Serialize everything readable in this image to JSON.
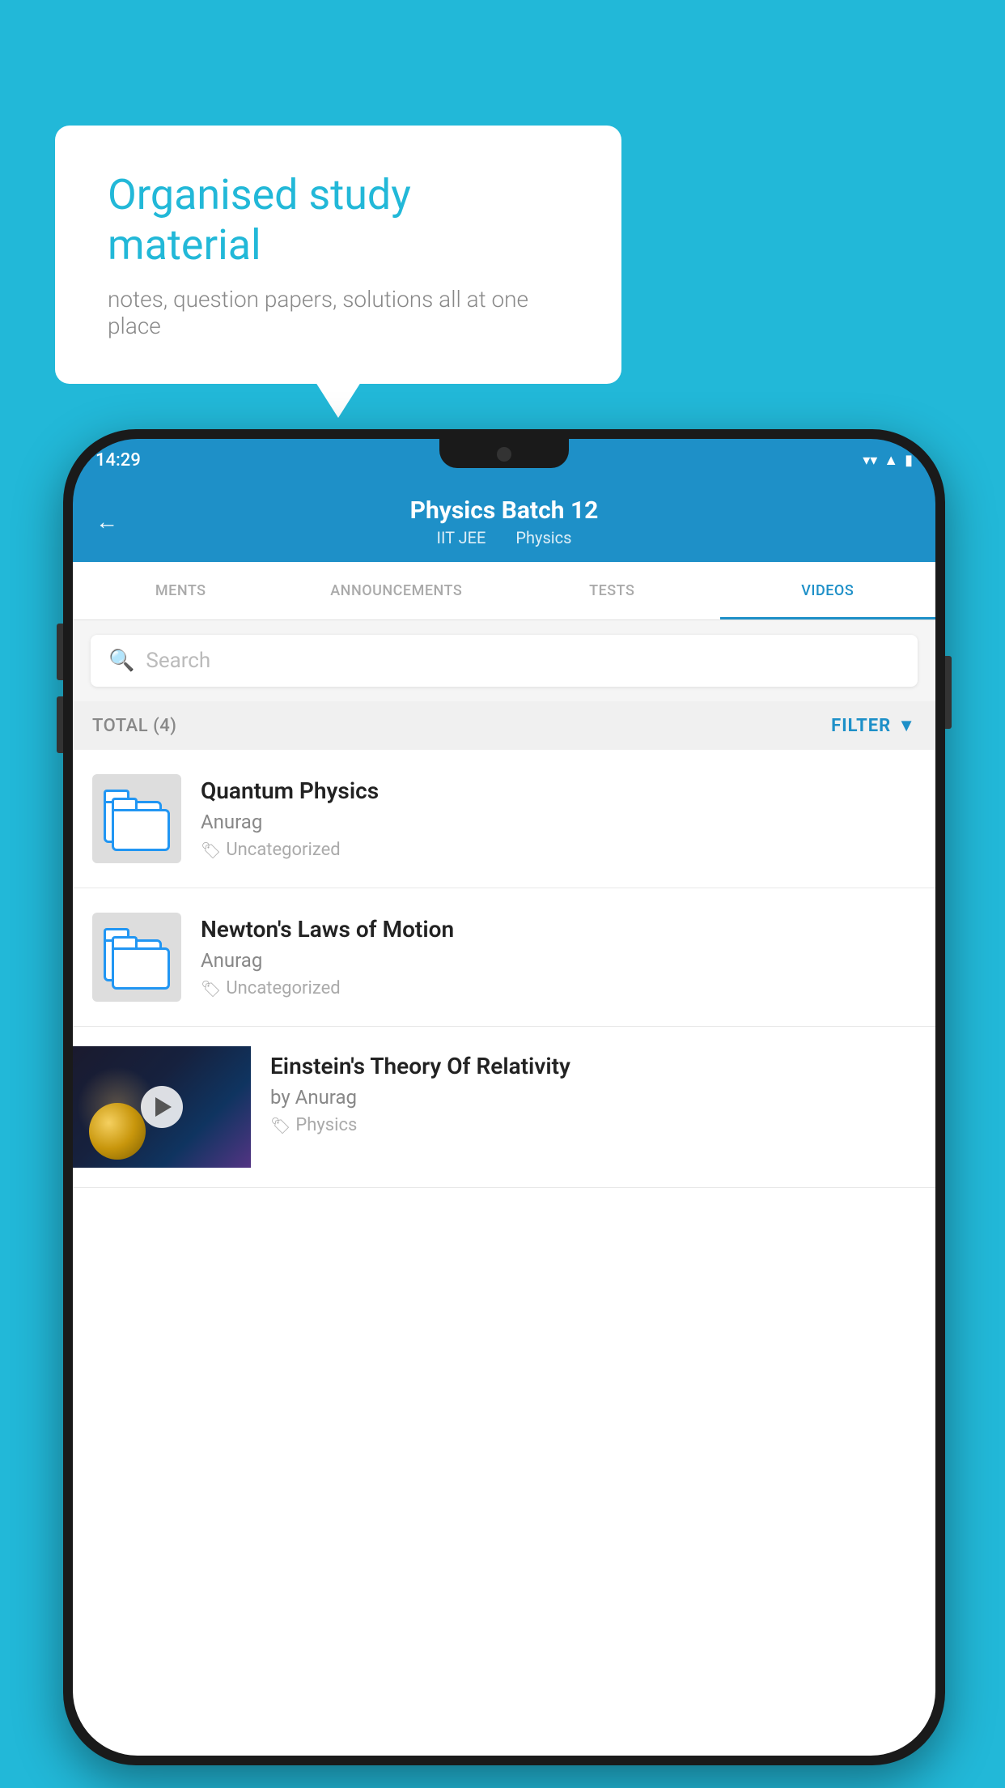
{
  "background": {
    "color": "#22b8d8"
  },
  "speech_bubble": {
    "title": "Organised study material",
    "subtitle": "notes, question papers, solutions all at one place"
  },
  "status_bar": {
    "time": "14:29",
    "wifi_icon": "▾",
    "signal_icon": "▲",
    "battery_icon": "▮"
  },
  "app_header": {
    "back_label": "←",
    "title": "Physics Batch 12",
    "subtitle_part1": "IIT JEE",
    "subtitle_part2": "Physics"
  },
  "tabs": [
    {
      "label": "MENTS",
      "active": false
    },
    {
      "label": "ANNOUNCEMENTS",
      "active": false
    },
    {
      "label": "TESTS",
      "active": false
    },
    {
      "label": "VIDEOS",
      "active": true
    }
  ],
  "search": {
    "placeholder": "Search"
  },
  "filter_bar": {
    "total_label": "TOTAL (4)",
    "filter_label": "FILTER"
  },
  "videos": [
    {
      "title": "Quantum Physics",
      "author": "Anurag",
      "tag": "Uncategorized",
      "has_thumbnail": false,
      "thumb_type": "folder"
    },
    {
      "title": "Newton's Laws of Motion",
      "author": "Anurag",
      "tag": "Uncategorized",
      "has_thumbnail": false,
      "thumb_type": "folder"
    },
    {
      "title": "Einstein's Theory Of Relativity",
      "author": "by Anurag",
      "tag": "Physics",
      "has_thumbnail": true,
      "thumb_type": "image"
    }
  ],
  "icons": {
    "search": "🔍",
    "tag": "🏷",
    "filter_funnel": "▼"
  }
}
